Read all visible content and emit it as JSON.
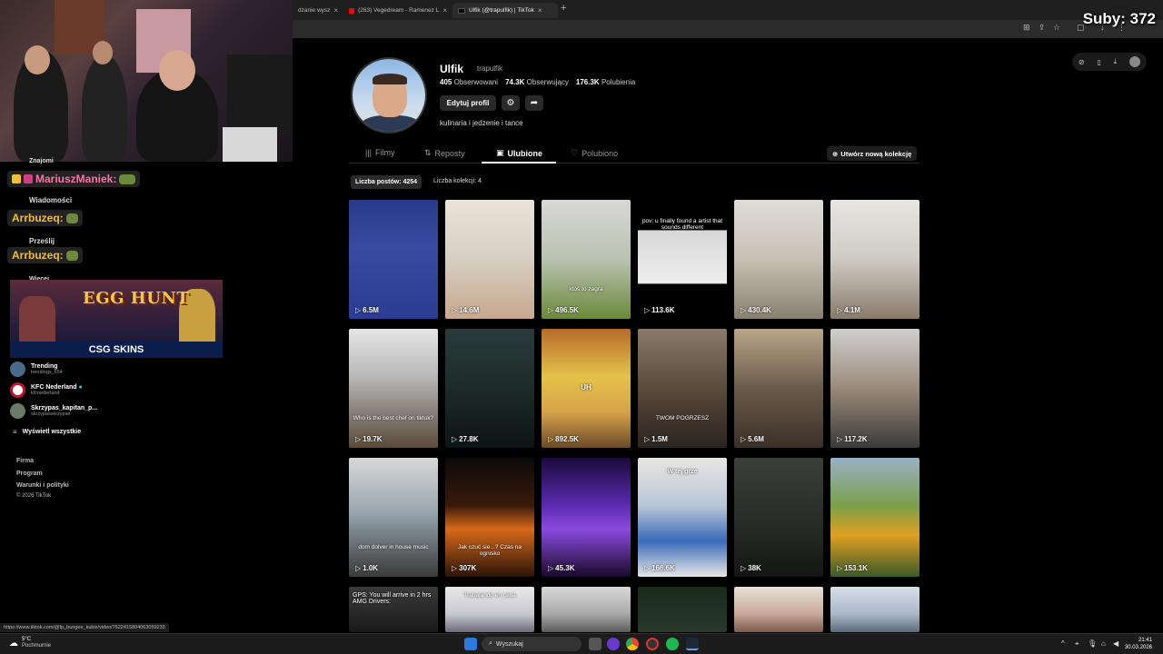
{
  "browser": {
    "tabs": [
      {
        "label": "dzanie wysz",
        "favicon_color": "#ffffff"
      },
      {
        "label": "(263) Vegedream - Ramenez L",
        "favicon_color": "#ff0000"
      },
      {
        "label": "Ulfik (@trapulfik) | TikTok",
        "favicon_color": "#000000"
      }
    ],
    "new_tab_label": "+",
    "close_glyph": "×"
  },
  "stream_overlay": {
    "subs_label": "Suby: 372"
  },
  "sidebar": {
    "znajomi": "Znajomi",
    "wiadomosci": "Wiadomości",
    "przeslij": "Prześlij",
    "wiecej": "Więcej",
    "chat": [
      {
        "user": "MariuszManiek:",
        "color": "#ff6fa8"
      },
      {
        "user": "Arrbuzeq:",
        "color": "#f0c030"
      },
      {
        "user": "Arrbuzeq:",
        "color": "#f0c030"
      }
    ],
    "banner": {
      "title": "EGG HUNT",
      "brand": "CSG SKINS"
    },
    "accounts": [
      {
        "name": "Trending",
        "handle": "trendings_654",
        "color": "#4a6a8a"
      },
      {
        "name": "KFC Nederland",
        "handle": "kfcnederland",
        "color": "#c8102e"
      },
      {
        "name": "Skrzypas_kapitan_p...",
        "handle": "skrzypasskrzypas",
        "color": "#6a7a6a"
      }
    ],
    "show_all": "Wyświetl wszystkie",
    "footer": [
      "Firma",
      "Program",
      "Warunki i polityki",
      "© 2026 TikTok"
    ]
  },
  "profile": {
    "name": "Ulfik",
    "handle": "trapulfik",
    "following_count": "405",
    "following_label": "Obserwowani",
    "followers_count": "74.3K",
    "followers_label": "Obserwujący",
    "likes_count": "176.3K",
    "likes_label": "Polubienia",
    "edit_button": "Edytuj profil",
    "bio": "kulinaria i jedzenie i tance"
  },
  "tabs": [
    {
      "label": "Filmy",
      "icon": "|||"
    },
    {
      "label": "Reposty",
      "icon": "⇅"
    },
    {
      "label": "Ulubione",
      "icon": "▣"
    },
    {
      "label": "Polubiono",
      "icon": "♡"
    }
  ],
  "new_collection": "Utwórz nową kolekcję",
  "counts": {
    "posts": "Liczba postów: 4254",
    "collections": "Liczba kolekcji: 4"
  },
  "play_glyph": "▷",
  "videos": [
    {
      "views": "6.5M",
      "bg": "linear-gradient(180deg,#2a3a8a 0%,#3a4aa0 40%,#2c3c90 100%)",
      "caption": ""
    },
    {
      "views": "14.6M",
      "bg": "linear-gradient(180deg,#e9e3d8 0%,#d7cfc3 50%,#c7a88e 100%)",
      "caption": ""
    },
    {
      "views": "496.5K",
      "bg": "linear-gradient(180deg,#d8d8d8 0%,#b9c2b0 50%,#6a8a3a 100%)",
      "caption": "ktoś to zagra"
    },
    {
      "views": "113.6K",
      "bg": "linear-gradient(180deg,#000 0%,#000 25%,#d8d8d8 26%,#eee 70%,#000 71%)",
      "caption": "pov: u finally found a artist that sounds different"
    },
    {
      "views": "430.4K",
      "bg": "linear-gradient(180deg,#e0ddd8 0%,#c9c0b4 50%,#8a8070 100%)",
      "caption": ""
    },
    {
      "views": "4.1M",
      "bg": "linear-gradient(180deg,#e8e6e2 0%,#cfcac4 50%,#8a7a6a 100%)",
      "caption": ""
    },
    {
      "views": "19.7K",
      "bg": "linear-gradient(180deg,#e6e6e6 0%,#b8b8b8 40%,#5a4a3a 100%)",
      "caption": "Who is the best chef on tiktok?"
    },
    {
      "views": "27.8K",
      "bg": "linear-gradient(180deg,#2a3a3a 0%,#1d2a2a 50%,#0d1414 100%)",
      "caption": ""
    },
    {
      "views": "892.5K",
      "bg": "linear-gradient(180deg,#b86a2a 0%,#e3c24a 40%,#d9a24a 70%,#6a4a2a 100%)",
      "caption": "UH"
    },
    {
      "views": "1.5M",
      "bg": "linear-gradient(180deg,#8a7a6a 0%,#5a4a3a 50%,#2a2420 100%)",
      "caption": "TWOM POGRZESZ"
    },
    {
      "views": "5.6M",
      "bg": "linear-gradient(180deg,#b9a78a 0%,#6a5a4a 50%,#3a3028 100%)",
      "caption": ""
    },
    {
      "views": "117.2K",
      "bg": "linear-gradient(180deg,#cfcfcf 0%,#9a8a7a 50%,#3a3a3a 100%)",
      "caption": ""
    },
    {
      "views": "1.0K",
      "bg": "linear-gradient(180deg,#d8d8d8 0%,#9aa6b0 45%,#3a3a3a 100%)",
      "caption": "dom dolver in house music"
    },
    {
      "views": "307K",
      "bg": "linear-gradient(180deg,#0a0a0a 0%,#3a1a0a 40%,#d86a1a 60%,#2a1408 100%)",
      "caption": "Jak czuć sie...? Czas na ognisko"
    },
    {
      "views": "45.3K",
      "bg": "linear-gradient(180deg,#1a0a3a 0%,#5a2ab0 40%,#8a4ae0 60%,#1a0a2a 100%)",
      "caption": ""
    },
    {
      "views": "166.6K",
      "bg": "linear-gradient(180deg,#e8e6e2 0%,#b8c6d8 40%,#3a6ab8 70%,#e6e6e6 100%)",
      "caption": "W tej grze"
    },
    {
      "views": "38K",
      "bg": "linear-gradient(180deg,#3a3f3a 0%,#2a2e2a 50%,#141614 100%)",
      "caption": ""
    },
    {
      "views": "153.1K",
      "bg": "linear-gradient(180deg,#9ab0c8 0%,#7aa04a 40%,#e0a020 65%,#3a5a2a 100%)",
      "caption": ""
    },
    {
      "views": "",
      "bg": "linear-gradient(180deg,#3a3a3a 0%,#1a1a1a 100%)",
      "caption": "GPS: You will arrive in 2 hrs   AMG Drivers:"
    },
    {
      "views": "",
      "bg": "linear-gradient(180deg,#e8e8e8 0%,#c8c8d0 60%,#6a6a7a 100%)",
      "caption": "Trabajando en casa"
    },
    {
      "views": "",
      "bg": "linear-gradient(180deg,#d8d8d8 0%,#a8a8a8 60%,#5a5a5a 100%)",
      "caption": ""
    },
    {
      "views": "",
      "bg": "linear-gradient(180deg,#1a2a1a 0%,#2a3a2a 100%)",
      "caption": ""
    },
    {
      "views": "",
      "bg": "linear-gradient(180deg,#e8e0d8 0%,#c8a898 60%,#7a5a4a 100%)",
      "caption": ""
    },
    {
      "views": "",
      "bg": "linear-gradient(180deg,#d8e0e8 0%,#a8b8c8 60%,#5a6a7a 100%)",
      "caption": ""
    }
  ],
  "status_url": "https://www.tiktok.com/@fp_bungee_kubix/video/7622415804063059233",
  "taskbar": {
    "temperature": "5°C",
    "weather_text": "Pochmurnie",
    "search_placeholder": "Wyszukaj",
    "time": "21:41",
    "date": "30.03.2026"
  }
}
